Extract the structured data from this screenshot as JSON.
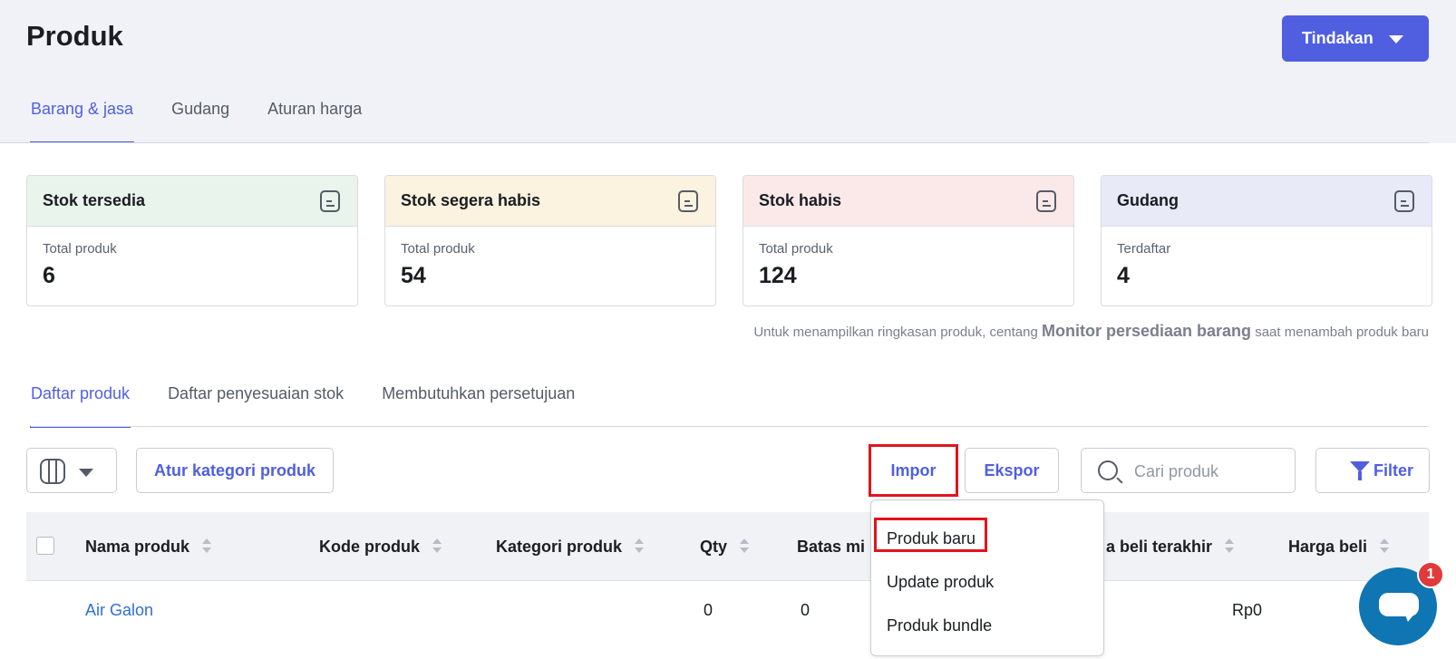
{
  "page": {
    "title": "Produk"
  },
  "header": {
    "action_label": "Tindakan",
    "accent_color": "#4f5fe0"
  },
  "main_tabs": [
    {
      "label": "Barang & jasa",
      "active": true
    },
    {
      "label": "Gudang",
      "active": false
    },
    {
      "label": "Aturan harga",
      "active": false
    }
  ],
  "summary_cards": [
    {
      "title": "Stok tersedia",
      "sub": "Total produk",
      "value": "6",
      "color": "#e9f4ec"
    },
    {
      "title": "Stok segera habis",
      "sub": "Total produk",
      "value": "54",
      "color": "#fbf2df"
    },
    {
      "title": "Stok habis",
      "sub": "Total produk",
      "value": "124",
      "color": "#fbe9ea"
    },
    {
      "title": "Gudang",
      "sub": "Terdaftar",
      "value": "4",
      "color": "#e8eaf8"
    }
  ],
  "hint": {
    "prefix": "Untuk menampilkan ringkasan produk, centang ",
    "bold": "Monitor persediaan barang",
    "suffix": " saat menambah produk baru"
  },
  "list_tabs": [
    {
      "label": "Daftar produk",
      "active": true
    },
    {
      "label": "Daftar penyesuaian stok",
      "active": false
    },
    {
      "label": "Membutuhkan persetujuan",
      "active": false
    }
  ],
  "toolbar": {
    "category_label": "Atur kategori produk",
    "import_label": "Impor",
    "export_label": "Ekspor",
    "search_placeholder": "Cari produk",
    "filter_label": "Filter"
  },
  "table": {
    "columns": [
      "Nama produk",
      "Kode produk",
      "Kategori produk",
      "Qty",
      "Batas mi",
      "a beli terakhir",
      "Harga beli"
    ],
    "rows": [
      {
        "name": "Air Galon",
        "code": "",
        "category": "",
        "qty": "0",
        "min": "0",
        "last_buy": "Rp0",
        "buy_price": ""
      }
    ]
  },
  "import_menu": {
    "items": [
      "Produk baru",
      "Update produk",
      "Produk bundle"
    ]
  },
  "chat": {
    "badge": "1"
  }
}
